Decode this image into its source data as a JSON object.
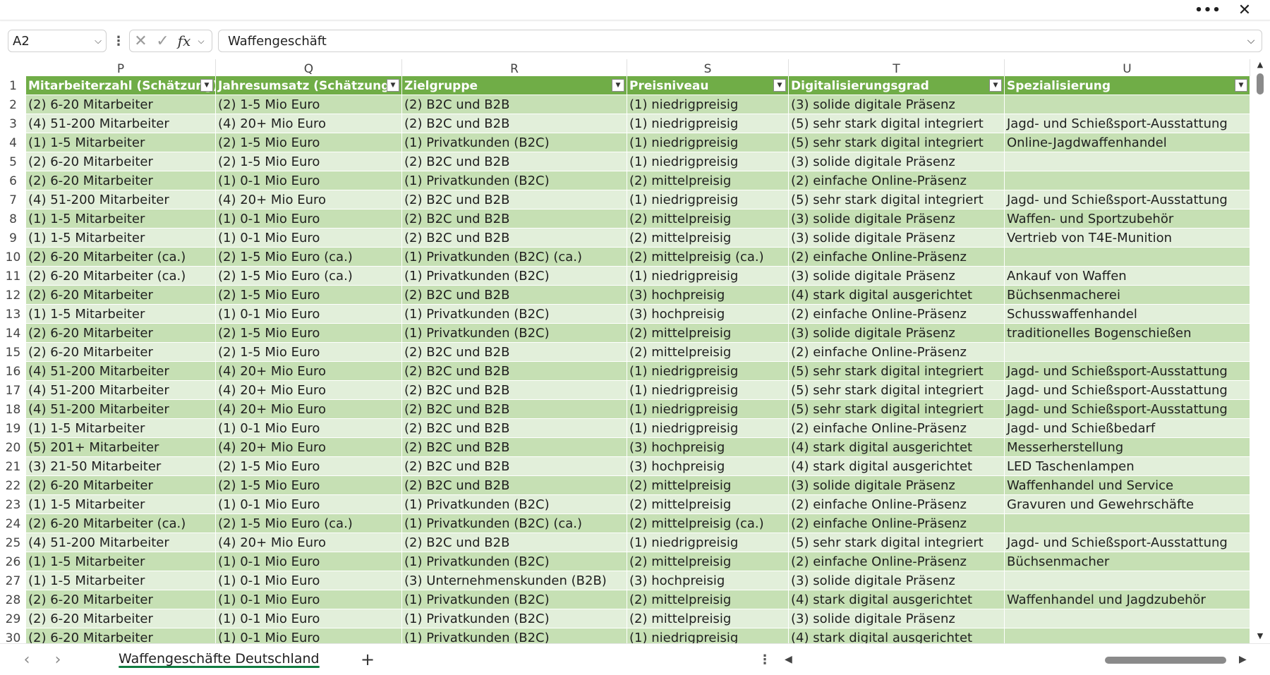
{
  "window": {
    "more_icon": "more-horizontal-icon",
    "more_label": "•••",
    "close_icon": "close-icon",
    "close_label": "✕"
  },
  "formula_bar": {
    "name_box": "A2",
    "cancel_label": "✕",
    "enter_label": "✓",
    "fx_label": "fx",
    "value": "Waffengeschäft"
  },
  "columns": [
    {
      "letter": "P",
      "header": "Mitarbeiterzahl (Schätzung)"
    },
    {
      "letter": "Q",
      "header": "Jahresumsatz (Schätzung)"
    },
    {
      "letter": "R",
      "header": "Zielgruppe"
    },
    {
      "letter": "S",
      "header": "Preisniveau"
    },
    {
      "letter": "T",
      "header": "Digitalisierungsgrad"
    },
    {
      "letter": "U",
      "header": "Spezialisierung"
    }
  ],
  "header_row_number": "1",
  "filter_glyph": "▼",
  "rows": [
    {
      "n": "2",
      "c": [
        "(2) 6-20 Mitarbeiter",
        "(2) 1-5 Mio Euro",
        "(2) B2C und B2B",
        "(1) niedrigpreisig",
        "(3) solide digitale Präsenz",
        ""
      ]
    },
    {
      "n": "3",
      "c": [
        "(4) 51-200 Mitarbeiter",
        "(4) 20+ Mio Euro",
        "(2) B2C und B2B",
        "(1) niedrigpreisig",
        "(5) sehr stark digital integriert",
        "Jagd- und Schießsport-Ausstattung"
      ]
    },
    {
      "n": "4",
      "c": [
        "(1) 1-5 Mitarbeiter",
        "(2) 1-5 Mio Euro",
        "(1) Privatkunden (B2C)",
        "(1) niedrigpreisig",
        "(5) sehr stark digital integriert",
        "Online-Jagdwaffenhandel"
      ]
    },
    {
      "n": "5",
      "c": [
        "(2) 6-20 Mitarbeiter",
        "(2) 1-5 Mio Euro",
        "(2) B2C und B2B",
        "(1) niedrigpreisig",
        "(3) solide digitale Präsenz",
        ""
      ]
    },
    {
      "n": "6",
      "c": [
        "(2) 6-20 Mitarbeiter",
        "(1) 0-1 Mio Euro",
        "(1) Privatkunden (B2C)",
        "(2) mittelpreisig",
        "(2) einfache Online-Präsenz",
        ""
      ]
    },
    {
      "n": "7",
      "c": [
        "(4) 51-200 Mitarbeiter",
        "(4) 20+ Mio Euro",
        "(2) B2C und B2B",
        "(1) niedrigpreisig",
        "(5) sehr stark digital integriert",
        "Jagd- und Schießsport-Ausstattung"
      ]
    },
    {
      "n": "8",
      "c": [
        "(1) 1-5 Mitarbeiter",
        "(1) 0-1 Mio Euro",
        "(2) B2C und B2B",
        "(2) mittelpreisig",
        "(3) solide digitale Präsenz",
        "Waffen- und Sportzubehör"
      ]
    },
    {
      "n": "9",
      "c": [
        "(1) 1-5 Mitarbeiter",
        "(1) 0-1 Mio Euro",
        "(2) B2C und B2B",
        "(2) mittelpreisig",
        "(3) solide digitale Präsenz",
        "Vertrieb von T4E-Munition"
      ]
    },
    {
      "n": "10",
      "c": [
        "(2) 6-20 Mitarbeiter (ca.)",
        "(2) 1-5 Mio Euro (ca.)",
        "(1) Privatkunden (B2C) (ca.)",
        "(2) mittelpreisig (ca.)",
        "(2) einfache Online-Präsenz",
        ""
      ]
    },
    {
      "n": "11",
      "c": [
        "(2) 6-20 Mitarbeiter (ca.)",
        "(2) 1-5 Mio Euro (ca.)",
        "(1) Privatkunden (B2C)",
        "(1) niedrigpreisig",
        "(3) solide digitale Präsenz",
        "Ankauf von Waffen"
      ]
    },
    {
      "n": "12",
      "c": [
        "(2) 6-20 Mitarbeiter",
        "(2) 1-5 Mio Euro",
        "(2) B2C und B2B",
        "(3) hochpreisig",
        "(4) stark digital ausgerichtet",
        "Büchsenmacherei"
      ]
    },
    {
      "n": "13",
      "c": [
        "(1) 1-5 Mitarbeiter",
        "(1) 0-1 Mio Euro",
        "(1) Privatkunden (B2C)",
        "(3) hochpreisig",
        "(2) einfache Online-Präsenz",
        "Schusswaffenhandel"
      ]
    },
    {
      "n": "14",
      "c": [
        "(2) 6-20 Mitarbeiter",
        "(2) 1-5 Mio Euro",
        "(1) Privatkunden (B2C)",
        "(2) mittelpreisig",
        "(3) solide digitale Präsenz",
        "traditionelles Bogenschießen"
      ]
    },
    {
      "n": "15",
      "c": [
        "(2) 6-20 Mitarbeiter",
        "(2) 1-5 Mio Euro",
        "(2) B2C und B2B",
        "(2) mittelpreisig",
        "(2) einfache Online-Präsenz",
        ""
      ]
    },
    {
      "n": "16",
      "c": [
        "(4) 51-200 Mitarbeiter",
        "(4) 20+ Mio Euro",
        "(2) B2C und B2B",
        "(1) niedrigpreisig",
        "(5) sehr stark digital integriert",
        "Jagd- und Schießsport-Ausstattung"
      ]
    },
    {
      "n": "17",
      "c": [
        "(4) 51-200 Mitarbeiter",
        "(4) 20+ Mio Euro",
        "(2) B2C und B2B",
        "(1) niedrigpreisig",
        "(5) sehr stark digital integriert",
        "Jagd- und Schießsport-Ausstattung"
      ]
    },
    {
      "n": "18",
      "c": [
        "(4) 51-200 Mitarbeiter",
        "(4) 20+ Mio Euro",
        "(2) B2C und B2B",
        "(1) niedrigpreisig",
        "(5) sehr stark digital integriert",
        "Jagd- und Schießsport-Ausstattung"
      ]
    },
    {
      "n": "19",
      "c": [
        "(1) 1-5 Mitarbeiter",
        "(1) 0-1 Mio Euro",
        "(2) B2C und B2B",
        "(1) niedrigpreisig",
        "(2) einfache Online-Präsenz",
        "Jagd- und Schießbedarf"
      ]
    },
    {
      "n": "20",
      "c": [
        "(5) 201+ Mitarbeiter",
        "(4) 20+ Mio Euro",
        "(2) B2C und B2B",
        "(3) hochpreisig",
        "(4) stark digital ausgerichtet",
        "Messerherstellung"
      ]
    },
    {
      "n": "21",
      "c": [
        "(3) 21-50 Mitarbeiter",
        "(2) 1-5 Mio Euro",
        "(2) B2C und B2B",
        "(3) hochpreisig",
        "(4) stark digital ausgerichtet",
        "LED Taschenlampen"
      ]
    },
    {
      "n": "22",
      "c": [
        "(2) 6-20 Mitarbeiter",
        "(2) 1-5 Mio Euro",
        "(2) B2C und B2B",
        "(2) mittelpreisig",
        "(3) solide digitale Präsenz",
        "Waffenhandel und Service"
      ]
    },
    {
      "n": "23",
      "c": [
        "(1) 1-5 Mitarbeiter",
        "(1) 0-1 Mio Euro",
        "(1) Privatkunden (B2C)",
        "(2) mittelpreisig",
        "(2) einfache Online-Präsenz",
        "Gravuren und Gewehrschäfte"
      ]
    },
    {
      "n": "24",
      "c": [
        "(2) 6-20 Mitarbeiter (ca.)",
        "(2) 1-5 Mio Euro (ca.)",
        "(1) Privatkunden (B2C) (ca.)",
        "(2) mittelpreisig (ca.)",
        "(2) einfache Online-Präsenz",
        ""
      ]
    },
    {
      "n": "25",
      "c": [
        "(4) 51-200 Mitarbeiter",
        "(4) 20+ Mio Euro",
        "(2) B2C und B2B",
        "(1) niedrigpreisig",
        "(5) sehr stark digital integriert",
        "Jagd- und Schießsport-Ausstattung"
      ]
    },
    {
      "n": "26",
      "c": [
        "(1) 1-5 Mitarbeiter",
        "(1) 0-1 Mio Euro",
        "(1) Privatkunden (B2C)",
        "(2) mittelpreisig",
        "(2) einfache Online-Präsenz",
        "Büchsenmacher"
      ]
    },
    {
      "n": "27",
      "c": [
        "(1) 1-5 Mitarbeiter",
        "(1) 0-1 Mio Euro",
        "(3) Unternehmenskunden (B2B)",
        "(3) hochpreisig",
        "(3) solide digitale Präsenz",
        ""
      ]
    },
    {
      "n": "28",
      "c": [
        "(2) 6-20 Mitarbeiter",
        "(1) 0-1 Mio Euro",
        "(1) Privatkunden (B2C)",
        "(2) mittelpreisig",
        "(4) stark digital ausgerichtet",
        "Waffenhandel und Jagdzubehör"
      ]
    },
    {
      "n": "29",
      "c": [
        "(2) 6-20 Mitarbeiter",
        "(1) 0-1 Mio Euro",
        "(1) Privatkunden (B2C)",
        "(2) mittelpreisig",
        "(3) solide digitale Präsenz",
        ""
      ]
    },
    {
      "n": "30",
      "c": [
        "(2) 6-20 Mitarbeiter",
        "(1) 0-1 Mio Euro",
        "(1) Privatkunden (B2C)",
        "(1) niedrigpreisig",
        "(4) stark digital ausgerichtet",
        ""
      ]
    }
  ],
  "sheet_bar": {
    "prev_label": "‹",
    "next_label": "›",
    "active_sheet": "Waffengeschäfte Deutschland",
    "add_label": "+",
    "more_label": "⋮",
    "scroll_left_label": "◀",
    "scroll_right_label": "▶"
  },
  "scrollbar": {
    "up_label": "▲",
    "down_label": "▼"
  }
}
